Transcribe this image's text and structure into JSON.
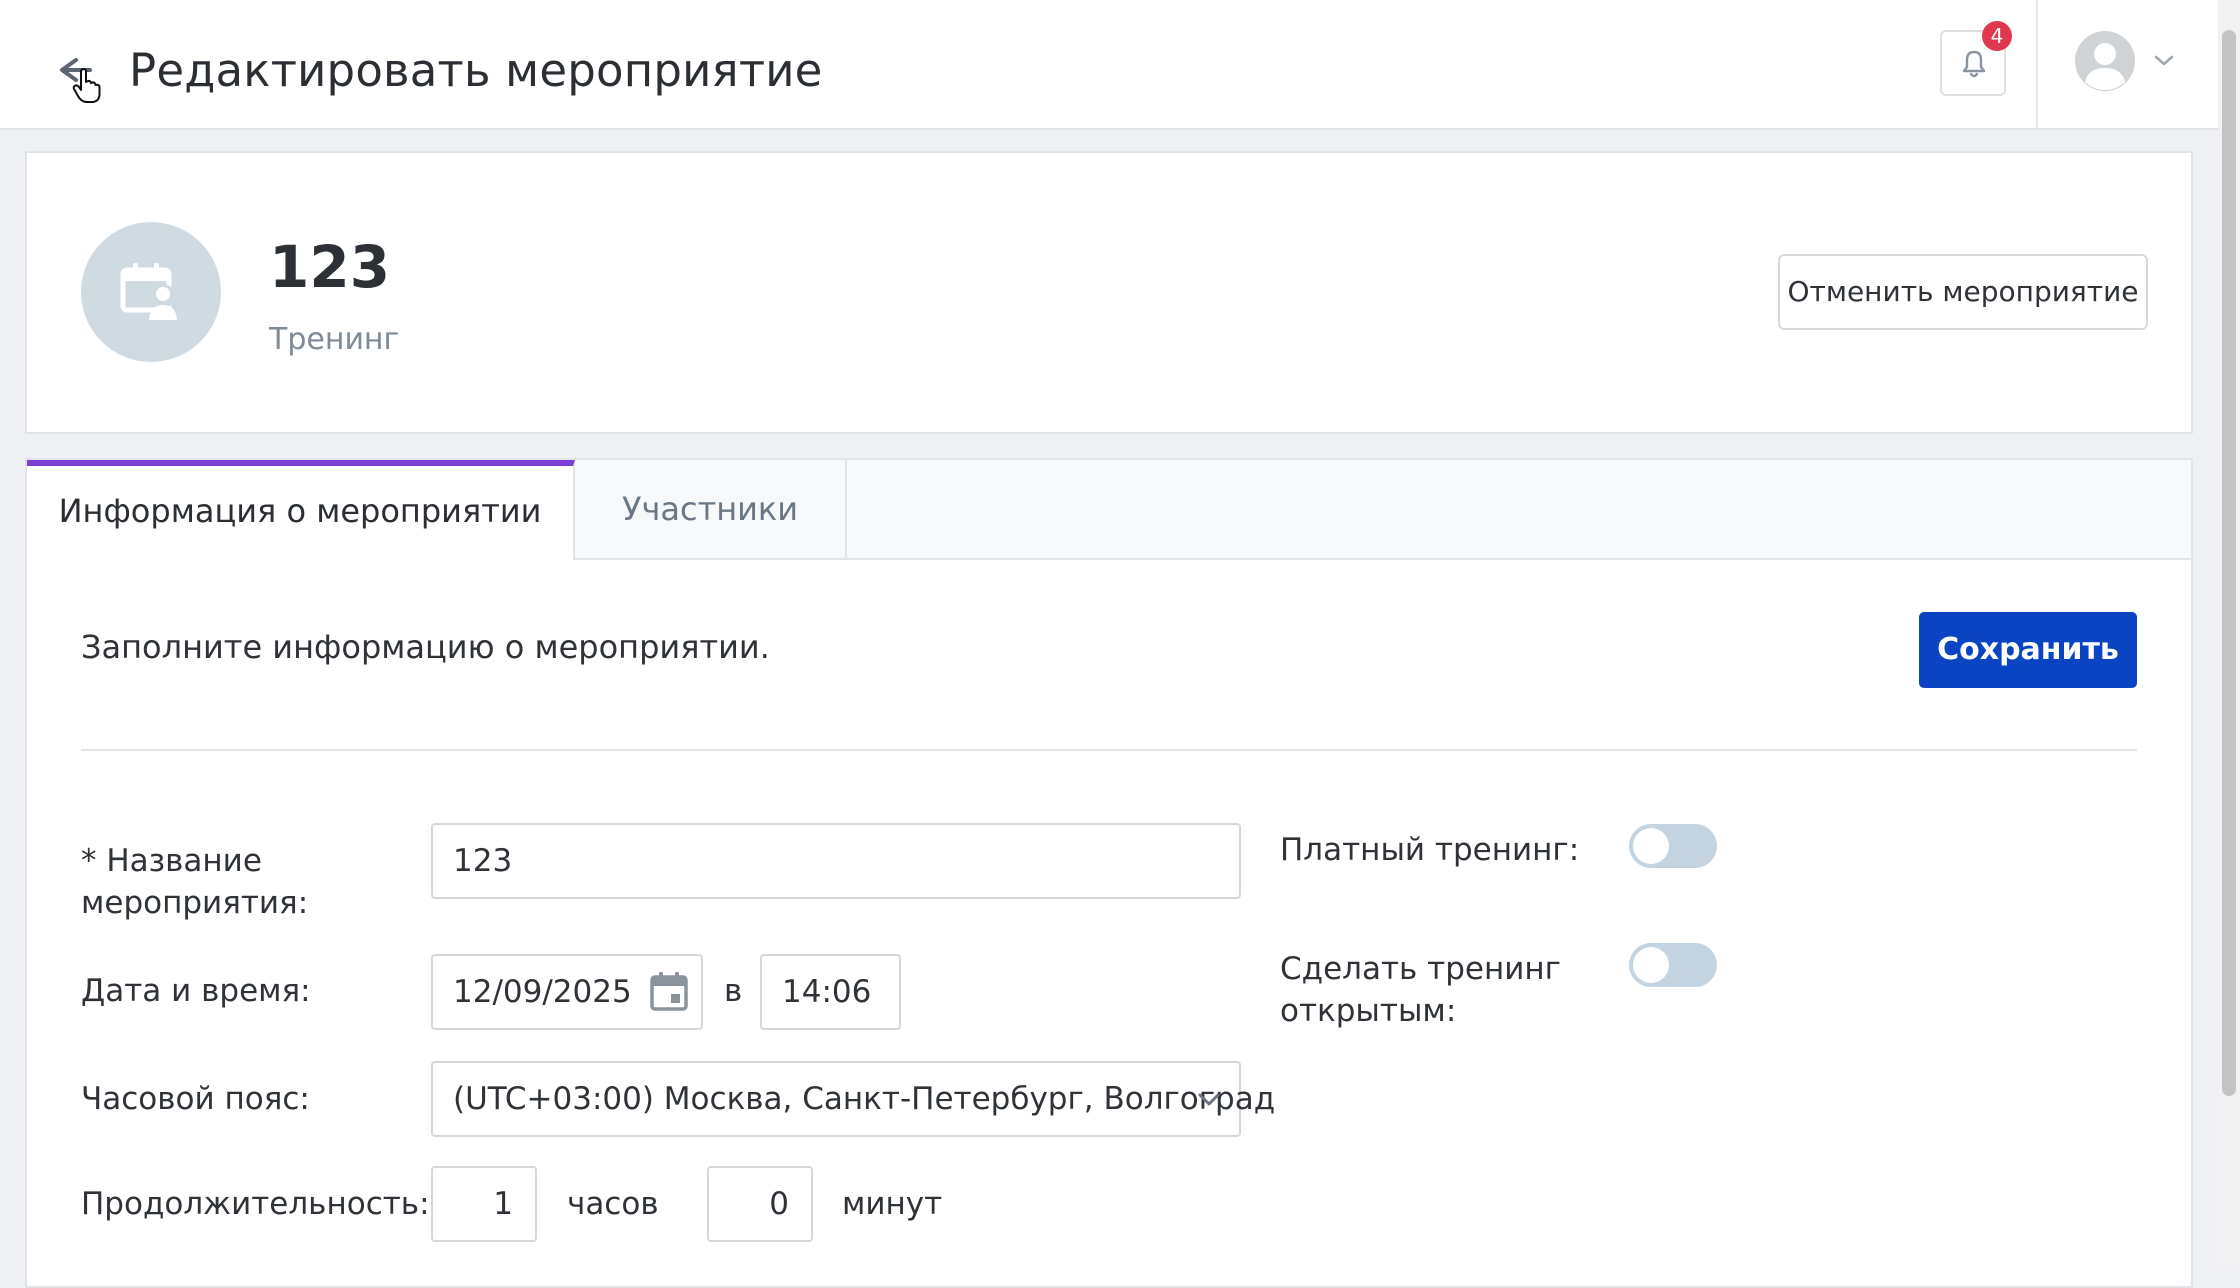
{
  "header": {
    "title": "Редактировать мероприятие",
    "notifications_count": "4"
  },
  "event": {
    "name": "123",
    "type": "Тренинг",
    "cancel_label": "Отменить мероприятие"
  },
  "tabs": [
    {
      "label": "Информация о мероприятии",
      "active": true
    },
    {
      "label": "Участники",
      "active": false
    }
  ],
  "form": {
    "intro": "Заполните информацию о мероприятии.",
    "save_label": "Сохранить",
    "name_label_line1": "* Название",
    "name_label_line2": "мероприятия:",
    "name_value": "123",
    "datetime_label": "Дата и время:",
    "date_value": "12/09/2025",
    "at_label": "в",
    "time_value": "14:06",
    "timezone_label": "Часовой пояс:",
    "timezone_value": "(UTC+03:00) Москва, Санкт-Петербург, Волгоград",
    "duration_label": "Продолжительность:",
    "hours_value": "1",
    "hours_label": "часов",
    "minutes_value": "0",
    "minutes_label": "минут",
    "paid_label": "Платный тренинг:",
    "paid_on": false,
    "open_label_line1": "Сделать тренинг",
    "open_label_line2": "открытым:",
    "open_on": false
  },
  "colors": {
    "accent_tab": "#7b3fd6",
    "primary_button": "#0a44c2",
    "badge": "#e0394f",
    "toggle_off": "#c3d3df"
  },
  "icons": [
    "back-arrow-icon",
    "cursor-hand-icon",
    "bell-icon",
    "user-avatar-icon",
    "chevron-down-icon",
    "calendar-user-icon",
    "calendar-icon"
  ]
}
